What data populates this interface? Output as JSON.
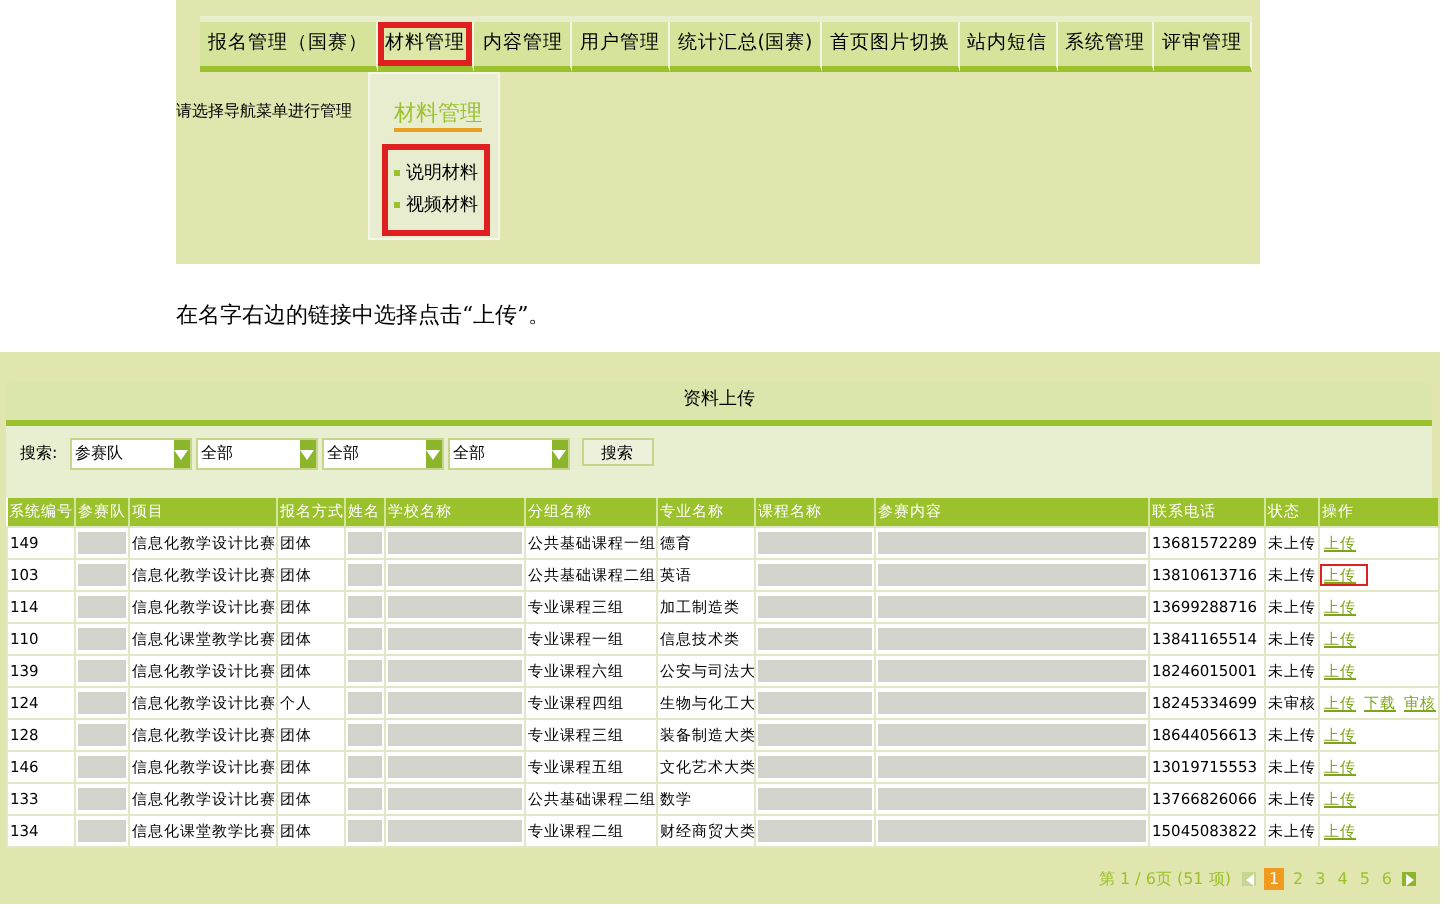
{
  "nav_screenshot": {
    "nav_items": [
      {
        "label": "报名管理（国赛）",
        "highlighted": false
      },
      {
        "label": "材料管理",
        "highlighted": true
      },
      {
        "label": "内容管理",
        "highlighted": false
      },
      {
        "label": "用户管理",
        "highlighted": false
      },
      {
        "label": "统计汇总(国赛)",
        "highlighted": false
      },
      {
        "label": "首页图片切换",
        "highlighted": false
      },
      {
        "label": "站内短信",
        "highlighted": false
      },
      {
        "label": "系统管理",
        "highlighted": false
      },
      {
        "label": "评审管理",
        "highlighted": false
      }
    ],
    "hint": "请选择导航菜单进行管理",
    "dropdown": {
      "title": "材料管理",
      "items": [
        "说明材料",
        "视频材料"
      ],
      "highlighted": true
    }
  },
  "caption": "在名字右边的链接中选择点击“上传”。",
  "upload_screenshot": {
    "title": "资料上传",
    "search": {
      "label": "搜索:",
      "selects": [
        "参赛队",
        "全部",
        "全部",
        "全部"
      ],
      "button": "搜索"
    },
    "columns": [
      "系统编号",
      "参赛队",
      "项目",
      "报名方式",
      "姓名",
      "学校名称",
      "分组名称",
      "专业名称",
      "课程名称",
      "参赛内容",
      "联系电话",
      "状态",
      "操作"
    ],
    "rows": [
      {
        "id": "149",
        "project": "信息化教学设计比赛",
        "method": "团体",
        "group": "公共基础课程一组",
        "major": "德育",
        "phone": "13681572289",
        "status": "未上传",
        "actions": [
          {
            "label": "上传",
            "highlighted": false
          }
        ]
      },
      {
        "id": "103",
        "project": "信息化教学设计比赛",
        "method": "团体",
        "group": "公共基础课程二组",
        "major": "英语",
        "phone": "13810613716",
        "status": "未上传",
        "actions": [
          {
            "label": "上传",
            "highlighted": true
          }
        ]
      },
      {
        "id": "114",
        "project": "信息化教学设计比赛",
        "method": "团体",
        "group": "专业课程三组",
        "major": "加工制造类",
        "phone": "13699288716",
        "status": "未上传",
        "actions": [
          {
            "label": "上传",
            "highlighted": false
          }
        ]
      },
      {
        "id": "110",
        "project": "信息化课堂教学比赛",
        "method": "团体",
        "group": "专业课程一组",
        "major": "信息技术类",
        "phone": "13841165514",
        "status": "未上传",
        "actions": [
          {
            "label": "上传",
            "highlighted": false
          }
        ]
      },
      {
        "id": "139",
        "project": "信息化教学设计比赛",
        "method": "团体",
        "group": "专业课程六组",
        "major": "公安与司法大",
        "phone": "18246015001",
        "status": "未上传",
        "actions": [
          {
            "label": "上传",
            "highlighted": false
          }
        ]
      },
      {
        "id": "124",
        "project": "信息化教学设计比赛",
        "method": "个人",
        "group": "专业课程四组",
        "major": "生物与化工大",
        "phone": "18245334699",
        "status": "未审核",
        "actions": [
          {
            "label": "上传",
            "highlighted": false
          },
          {
            "label": "下载",
            "highlighted": false
          },
          {
            "label": "审核",
            "highlighted": false
          }
        ]
      },
      {
        "id": "128",
        "project": "信息化教学设计比赛",
        "method": "团体",
        "group": "专业课程三组",
        "major": "装备制造大类",
        "phone": "18644056613",
        "status": "未上传",
        "actions": [
          {
            "label": "上传",
            "highlighted": false
          }
        ]
      },
      {
        "id": "146",
        "project": "信息化教学设计比赛",
        "method": "团体",
        "group": "专业课程五组",
        "major": "文化艺术大类",
        "phone": "13019715553",
        "status": "未上传",
        "actions": [
          {
            "label": "上传",
            "highlighted": false
          }
        ]
      },
      {
        "id": "133",
        "project": "信息化教学设计比赛",
        "method": "团体",
        "group": "公共基础课程二组",
        "major": "数学",
        "phone": "13766826066",
        "status": "未上传",
        "actions": [
          {
            "label": "上传",
            "highlighted": false
          }
        ]
      },
      {
        "id": "134",
        "project": "信息化课堂教学比赛",
        "method": "团体",
        "group": "专业课程二组",
        "major": "财经商贸大类",
        "phone": "15045083822",
        "status": "未上传",
        "actions": [
          {
            "label": "上传",
            "highlighted": false
          }
        ]
      }
    ],
    "pagination": {
      "summary": "第 1 / 6页 (51 项)",
      "pages": [
        {
          "label": "1",
          "selected": true
        },
        {
          "label": "2",
          "selected": false
        },
        {
          "label": "3",
          "selected": false
        },
        {
          "label": "4",
          "selected": false
        },
        {
          "label": "5",
          "selected": false
        },
        {
          "label": "6",
          "selected": false
        }
      ]
    }
  }
}
